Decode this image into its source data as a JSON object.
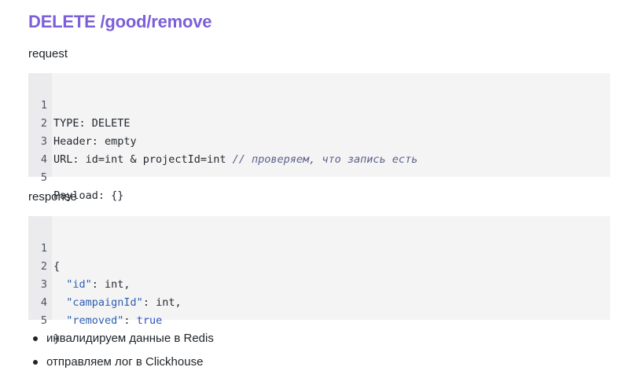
{
  "title": "DELETE /good/remove",
  "request": {
    "label": "request",
    "lines": [
      {
        "num": "1",
        "code": "TYPE: DELETE",
        "comment": ""
      },
      {
        "num": "2",
        "code": "Header: empty",
        "comment": ""
      },
      {
        "num": "3",
        "code": "URL: id=int & projectId=int ",
        "comment": "// проверяем, что запись есть"
      },
      {
        "num": "4",
        "code": "",
        "comment": ""
      },
      {
        "num": "5",
        "code": "Payload: {}",
        "comment": ""
      }
    ]
  },
  "response": {
    "label": "response",
    "lines": [
      {
        "num": "1",
        "indent": "",
        "key": "",
        "rest": "{",
        "value_kw": ""
      },
      {
        "num": "2",
        "indent": "  ",
        "key": "\"id\"",
        "rest": ": int,",
        "value_kw": ""
      },
      {
        "num": "3",
        "indent": "  ",
        "key": "\"campaignId\"",
        "rest": ": int,",
        "value_kw": ""
      },
      {
        "num": "4",
        "indent": "  ",
        "key": "\"removed\"",
        "rest": ": ",
        "value_kw": "true"
      },
      {
        "num": "5",
        "indent": "",
        "key": "",
        "rest": "}",
        "value_kw": ""
      }
    ]
  },
  "bullets": [
    "инвалидируем данные в Redis",
    "отправляем лог в Clickhouse"
  ]
}
